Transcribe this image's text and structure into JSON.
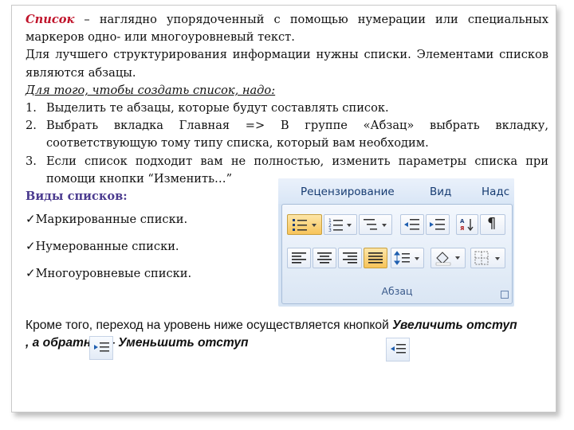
{
  "paragraph1": {
    "term": "Список",
    "rest": " – наглядно упорядоченный с помощью нумерации или специальных маркеров одно- или многоуровневый текст."
  },
  "paragraph2": "Для лучшего структурирования информации нужны списки. Элементами списков являются абзацы.",
  "howto_heading": "Для того, чтобы создать список, надо:",
  "steps": [
    {
      "num": "1.",
      "text": "Выделить те абзацы, которые будут составлять список."
    },
    {
      "num": "2.",
      "text": "Выбрать вкладка Главная => В группе «Абзац» выбрать вкладку, соответствующую тому типу списка, который вам необходим."
    },
    {
      "num": "3.",
      "text": "Если список подходит вам не полностью, изменить параметры списка при помощи кнопки “Изменить…”"
    }
  ],
  "kinds_heading": "Виды списков:",
  "list_types": [
    {
      "mark": "ü",
      "label": "Маркированные списки."
    },
    {
      "mark": "ü",
      "label": "Нумерованные списки."
    },
    {
      "mark": "ü",
      "label": "Многоуровневые списки."
    }
  ],
  "ribbon": {
    "tabs": [
      "Рецензирование",
      "Вид",
      "Надс"
    ],
    "group_label": "Абзац"
  },
  "footer": {
    "part1": "Кроме того, переход на уровень ниже осуществляется кнопкой ",
    "bold1": "Увеличить отступ",
    "part2": " , а обратно — ",
    "bold2": "Уменьшить отступ"
  },
  "colors": {
    "term": "#c0142b",
    "kinds_heading": "#4b3b8f",
    "ribbon_bg": "#d5e3f3",
    "highlight": "#f7c45a"
  },
  "icons": [
    "bullets-icon",
    "numbering-icon",
    "multilevel-list-icon",
    "decrease-indent-icon",
    "increase-indent-icon",
    "sort-icon",
    "show-formatting-icon",
    "align-left-icon",
    "center-icon",
    "align-right-icon",
    "justify-icon",
    "line-spacing-icon",
    "shading-icon",
    "borders-icon",
    "dialog-launcher-icon"
  ]
}
